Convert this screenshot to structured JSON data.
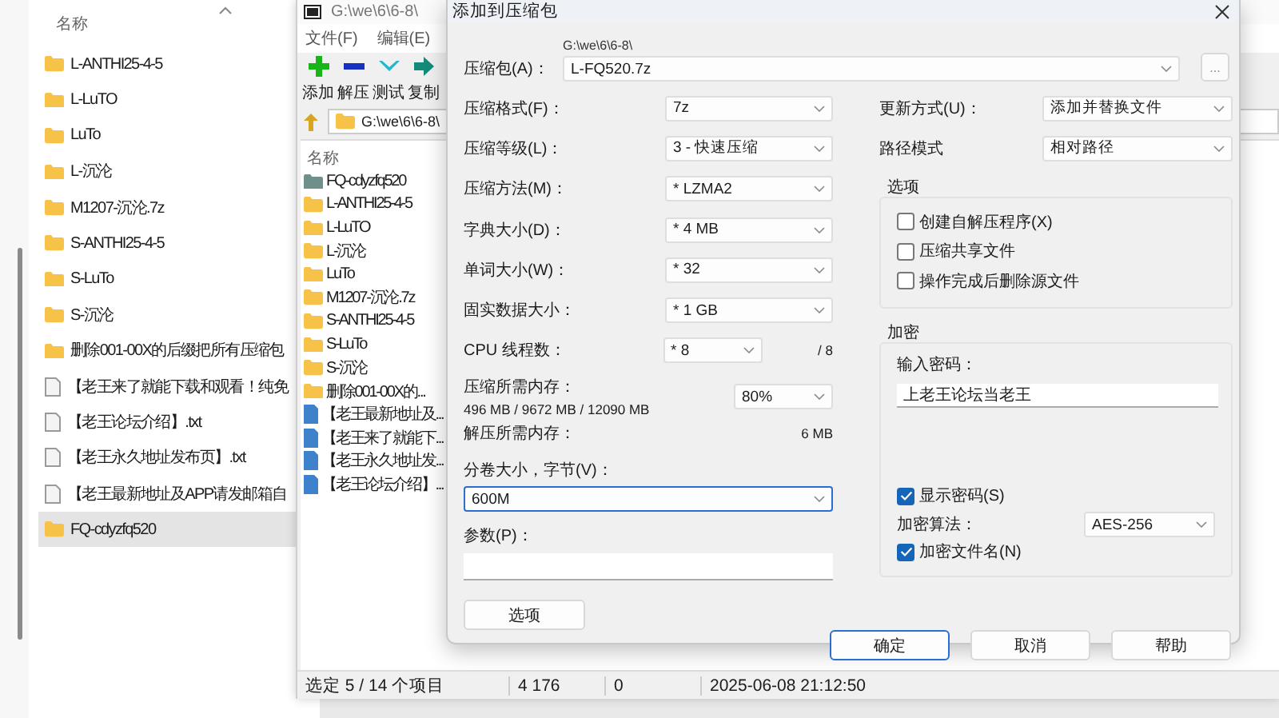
{
  "explorer": {
    "column_header": "名称",
    "items": [
      {
        "name": "L-ANTHI25-4-5",
        "kind": "folder",
        "selected": false
      },
      {
        "name": "L-LuTO",
        "kind": "folder",
        "selected": false
      },
      {
        "name": "LuTo",
        "kind": "folder",
        "selected": false
      },
      {
        "name": "L-沉沦",
        "kind": "folder",
        "selected": false
      },
      {
        "name": "M1207-沉沦.7z",
        "kind": "folder",
        "selected": false
      },
      {
        "name": "S-ANTHI25-4-5",
        "kind": "folder",
        "selected": false
      },
      {
        "name": "S-LuTo",
        "kind": "folder",
        "selected": false
      },
      {
        "name": "S-沉沦",
        "kind": "folder",
        "selected": false
      },
      {
        "name": "删除001-00X的后缀把所有压缩包",
        "kind": "folder",
        "selected": false
      },
      {
        "name": "【老王来了就能下载和观看！纯免",
        "kind": "text",
        "selected": false
      },
      {
        "name": "【老王论坛介绍】.txt",
        "kind": "text",
        "selected": false
      },
      {
        "name": "【老王永久地址发布页】.txt",
        "kind": "text",
        "selected": false
      },
      {
        "name": "【老王最新地址及APP请发邮箱自",
        "kind": "text",
        "selected": false
      },
      {
        "name": "FQ-cdyzfq520",
        "kind": "folder",
        "selected": true
      }
    ]
  },
  "archiver": {
    "title": "G:\\we\\6\\6-8\\",
    "menu": [
      "文件(F)",
      "编辑(E)"
    ],
    "toolbar": [
      {
        "label": "添加",
        "kind": "add"
      },
      {
        "label": "解压",
        "kind": "extract"
      },
      {
        "label": "测试",
        "kind": "test"
      },
      {
        "label": "复制",
        "kind": "copy"
      }
    ],
    "address": "G:\\we\\6\\6-8\\",
    "column_header": "名称",
    "items": [
      {
        "name": "FQ-cdyzfq520",
        "kind": "dim-folder"
      },
      {
        "name": "L-ANTHI25-4-5",
        "kind": "folder"
      },
      {
        "name": "L-LuTO",
        "kind": "folder"
      },
      {
        "name": "L-沉沦",
        "kind": "folder"
      },
      {
        "name": "LuTo",
        "kind": "folder"
      },
      {
        "name": "M1207-沉沦.7z",
        "kind": "folder"
      },
      {
        "name": "S-ANTHI25-4-5",
        "kind": "folder"
      },
      {
        "name": "S-LuTo",
        "kind": "folder"
      },
      {
        "name": "S-沉沦",
        "kind": "folder"
      },
      {
        "name": "删除001-00X的...",
        "kind": "folder"
      },
      {
        "name": "【老王最新地址及...",
        "kind": "file"
      },
      {
        "name": "【老王来了就能下...",
        "kind": "file"
      },
      {
        "name": "【老王永久地址发...",
        "kind": "file"
      },
      {
        "name": "【老王论坛介绍】...",
        "kind": "file"
      }
    ],
    "status": "选定 5 / 14 个项目",
    "status_cells": [
      "4 176",
      "0",
      "2025-06-08 21:12:50"
    ]
  },
  "dialog": {
    "title": "添加到压缩包",
    "archive": {
      "label": "压缩包(A)：",
      "path": "G:\\we\\6\\6-8\\",
      "value": "L-FQ520.7z",
      "browse": "..."
    },
    "settings": [
      {
        "label": "压缩格式(F)：",
        "value": "7z"
      },
      {
        "label": "压缩等级(L)：",
        "value": "3 - 快速压缩"
      },
      {
        "label": "压缩方法(M)：",
        "value": "* LZMA2"
      },
      {
        "label": "字典大小(D)：",
        "value": "* 4 MB"
      },
      {
        "label": "单词大小(W)：",
        "value": "* 32"
      },
      {
        "label": "固实数据大小：",
        "value": "* 1 GB"
      }
    ],
    "threads": {
      "label": "CPU 线程数：",
      "value": "* 8",
      "max": "/ 8"
    },
    "memory": {
      "label": "压缩所需内存：",
      "detail": "496 MB / 9672 MB / 12090 MB",
      "value": "80%"
    },
    "decompress": {
      "label": "解压所需内存：",
      "value": "6 MB"
    },
    "split": {
      "label": "分卷大小，字节(V)：",
      "value": "600M",
      "focused": true
    },
    "params": {
      "label": "参数(P)："
    },
    "options_button": "选项",
    "right_settings": [
      {
        "label": "更新方式(U)：",
        "value": "添加并替换文件"
      },
      {
        "label": "路径模式",
        "value": "相对路径"
      }
    ],
    "options_group": {
      "title": "选项",
      "checks": [
        {
          "label": "创建自解压程序(X)",
          "checked": false
        },
        {
          "label": "压缩共享文件",
          "checked": false
        },
        {
          "label": "操作完成后删除源文件",
          "checked": false
        }
      ]
    },
    "encryption": {
      "title": "加密",
      "password_label": "输入密码：",
      "password": "上老王论坛当老王",
      "show_password": {
        "label": "显示密码(S)",
        "checked": true
      },
      "method": {
        "label": "加密算法：",
        "value": "AES-256"
      },
      "encrypt_names": {
        "label": "加密文件名(N)",
        "checked": true
      }
    },
    "buttons": [
      {
        "label": "确定",
        "default": true
      },
      {
        "label": "取消",
        "default": false
      },
      {
        "label": "帮助",
        "default": false
      }
    ]
  }
}
